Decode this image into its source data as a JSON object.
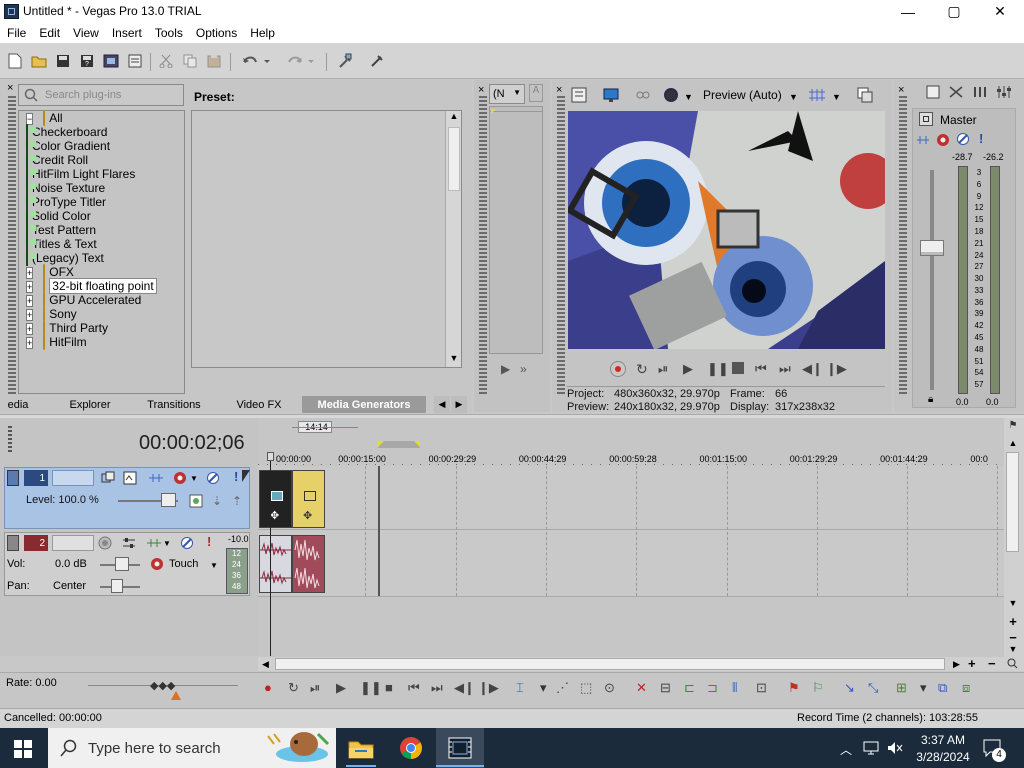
{
  "window": {
    "title": "Untitled * - Vegas Pro 13.0 TRIAL",
    "minimize": "—",
    "maximize": "▢",
    "close": "✕"
  },
  "menu": [
    "File",
    "Edit",
    "View",
    "Insert",
    "Tools",
    "Options",
    "Help"
  ],
  "toolbar_icons": [
    "new-icon",
    "open-icon",
    "save-icon",
    "save-as-icon",
    "render-icon",
    "properties-icon",
    "cut-icon",
    "copy-icon",
    "paste-icon",
    "undo-icon",
    "redo-icon",
    "enable-snapping-icon",
    "cursor-icon"
  ],
  "plugins": {
    "search_placeholder": "Search plug-ins",
    "preset_label": "Preset:",
    "tree": [
      {
        "label": "All",
        "type": "folder",
        "expand": "−",
        "level": 0
      },
      {
        "label": "Checkerboard",
        "type": "plugin",
        "level": 1
      },
      {
        "label": "Color Gradient",
        "type": "plugin",
        "level": 1
      },
      {
        "label": "Credit Roll",
        "type": "plugin",
        "level": 1
      },
      {
        "label": "HitFilm Light Flares",
        "type": "plugin",
        "level": 1
      },
      {
        "label": "Noise Texture",
        "type": "plugin",
        "level": 1
      },
      {
        "label": "ProType Titler",
        "type": "plugin",
        "level": 1
      },
      {
        "label": "Solid Color",
        "type": "plugin",
        "level": 1
      },
      {
        "label": "Test Pattern",
        "type": "plugin",
        "level": 1
      },
      {
        "label": "Titles & Text",
        "type": "plugin",
        "level": 1
      },
      {
        "label": "(Legacy) Text",
        "type": "plugin",
        "level": 1
      },
      {
        "label": "OFX",
        "type": "folder",
        "expand": "+",
        "level": 0
      },
      {
        "label": "32-bit floating point",
        "type": "folder",
        "expand": "+",
        "level": 0,
        "selected": true
      },
      {
        "label": "GPU Accelerated",
        "type": "folder",
        "expand": "+",
        "level": 0
      },
      {
        "label": "Sony",
        "type": "folder",
        "expand": "+",
        "level": 0
      },
      {
        "label": "Third Party",
        "type": "folder",
        "expand": "+",
        "level": 0
      },
      {
        "label": "HitFilm",
        "type": "folder",
        "expand": "+",
        "level": 0
      }
    ]
  },
  "tabs": [
    {
      "label": "edia",
      "active": false
    },
    {
      "label": "Explorer",
      "active": false
    },
    {
      "label": "Transitions",
      "active": false
    },
    {
      "label": "Video FX",
      "active": false
    },
    {
      "label": "Media Generators",
      "active": true
    }
  ],
  "trimmer": {
    "dropdown": "(N"
  },
  "preview": {
    "mode": "Preview (Auto)",
    "project_label": "Project:",
    "project_value": "480x360x32, 29.970p",
    "frame_label": "Frame:",
    "frame_value": "66",
    "preview_label": "Preview:",
    "preview_value": "240x180x32, 29.970p",
    "display_label": "Display:",
    "display_value": "317x238x32"
  },
  "master": {
    "label": "Master",
    "peak_left": "-28.7",
    "peak_right": "-26.2",
    "scale": [
      "3",
      "6",
      "9",
      "12",
      "15",
      "18",
      "21",
      "24",
      "27",
      "30",
      "33",
      "36",
      "39",
      "42",
      "45",
      "48",
      "51",
      "54",
      "57"
    ],
    "level_left": "0.0",
    "level_right": "0.0"
  },
  "timeline": {
    "timecode": "00:00:02;06",
    "loop_marker": "-14:14",
    "ruler": [
      "00:00:00",
      "00:00:15:00",
      "00:00:29:29",
      "00:00:44:29",
      "00:00:59:28",
      "00:01:15:00",
      "00:01:29:29",
      "00:01:44:29",
      "00:0"
    ],
    "video_track": {
      "number": "1",
      "level": "Level: 100.0 %"
    },
    "audio_track": {
      "number": "2",
      "vol_label": "Vol:",
      "vol_value": "0.0 dB",
      "pan_label": "Pan:",
      "pan_value": "Center",
      "automation": "Touch",
      "peak": "-10.0",
      "meter": [
        "12",
        "24",
        "36",
        "48"
      ]
    },
    "rate": "Rate: 0.00"
  },
  "status": {
    "left": "Cancelled: 00:00:00",
    "right": "Record Time (2 channels): 103:28:55"
  },
  "taskbar": {
    "search_placeholder": "Type here to search",
    "time": "3:37 AM",
    "date": "3/28/2024",
    "notifications": "4"
  }
}
